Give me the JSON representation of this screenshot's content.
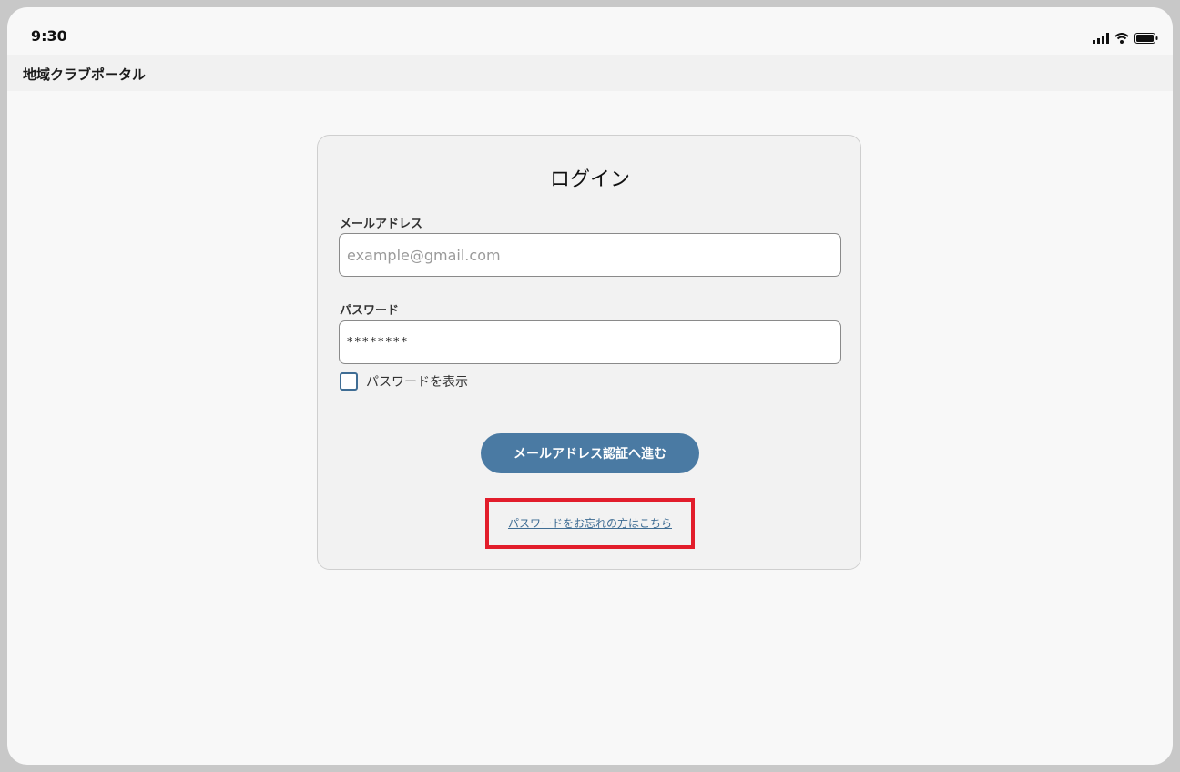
{
  "status_bar": {
    "time": "9:30",
    "icons": [
      "signal-icon",
      "wifi-icon",
      "battery-icon"
    ]
  },
  "app_bar": {
    "title": "地域クラブポータル"
  },
  "login_card": {
    "title": "ログイン",
    "email": {
      "label": "メールアドレス",
      "placeholder": "example@gmail.com",
      "value": ""
    },
    "password": {
      "label": "パスワード",
      "value": "********"
    },
    "show_password": {
      "label": "パスワードを表示",
      "checked": false
    },
    "submit_label": "メールアドレス認証へ進む",
    "forgot_link_label": "パスワードをお忘れの方はこちら"
  },
  "colors": {
    "accent": "#4a7aa3",
    "link": "#3f6d94",
    "highlight": "#e21d2b"
  }
}
